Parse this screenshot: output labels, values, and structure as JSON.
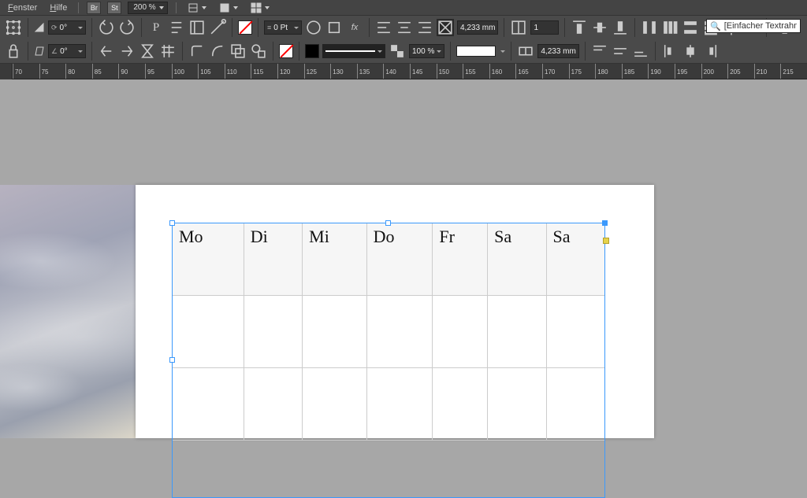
{
  "menubar": {
    "items": [
      {
        "label": "Fenster",
        "u": "F"
      },
      {
        "label": "Hilfe",
        "u": "H"
      }
    ],
    "br_label": "Br",
    "st_label": "St",
    "zoom": "200 %"
  },
  "controls": {
    "row1": {
      "angle_a": "0°",
      "angle_b": "0°",
      "char_P": "P",
      "stroke_weight": "0 Pt",
      "fx_label": "fx",
      "cell_h": "4,233 mm",
      "col_count": "1"
    },
    "row2": {
      "scale": "100 %",
      "cell_h2": "4,233 mm"
    },
    "search_placeholder": "[Einfacher Textrahmen]+"
  },
  "ruler": {
    "start": 70,
    "step": 5,
    "count": 31
  },
  "table": {
    "headers": [
      "Mo",
      "Di",
      "Mi",
      "Do",
      "Fr",
      "Sa",
      "Sa"
    ]
  }
}
